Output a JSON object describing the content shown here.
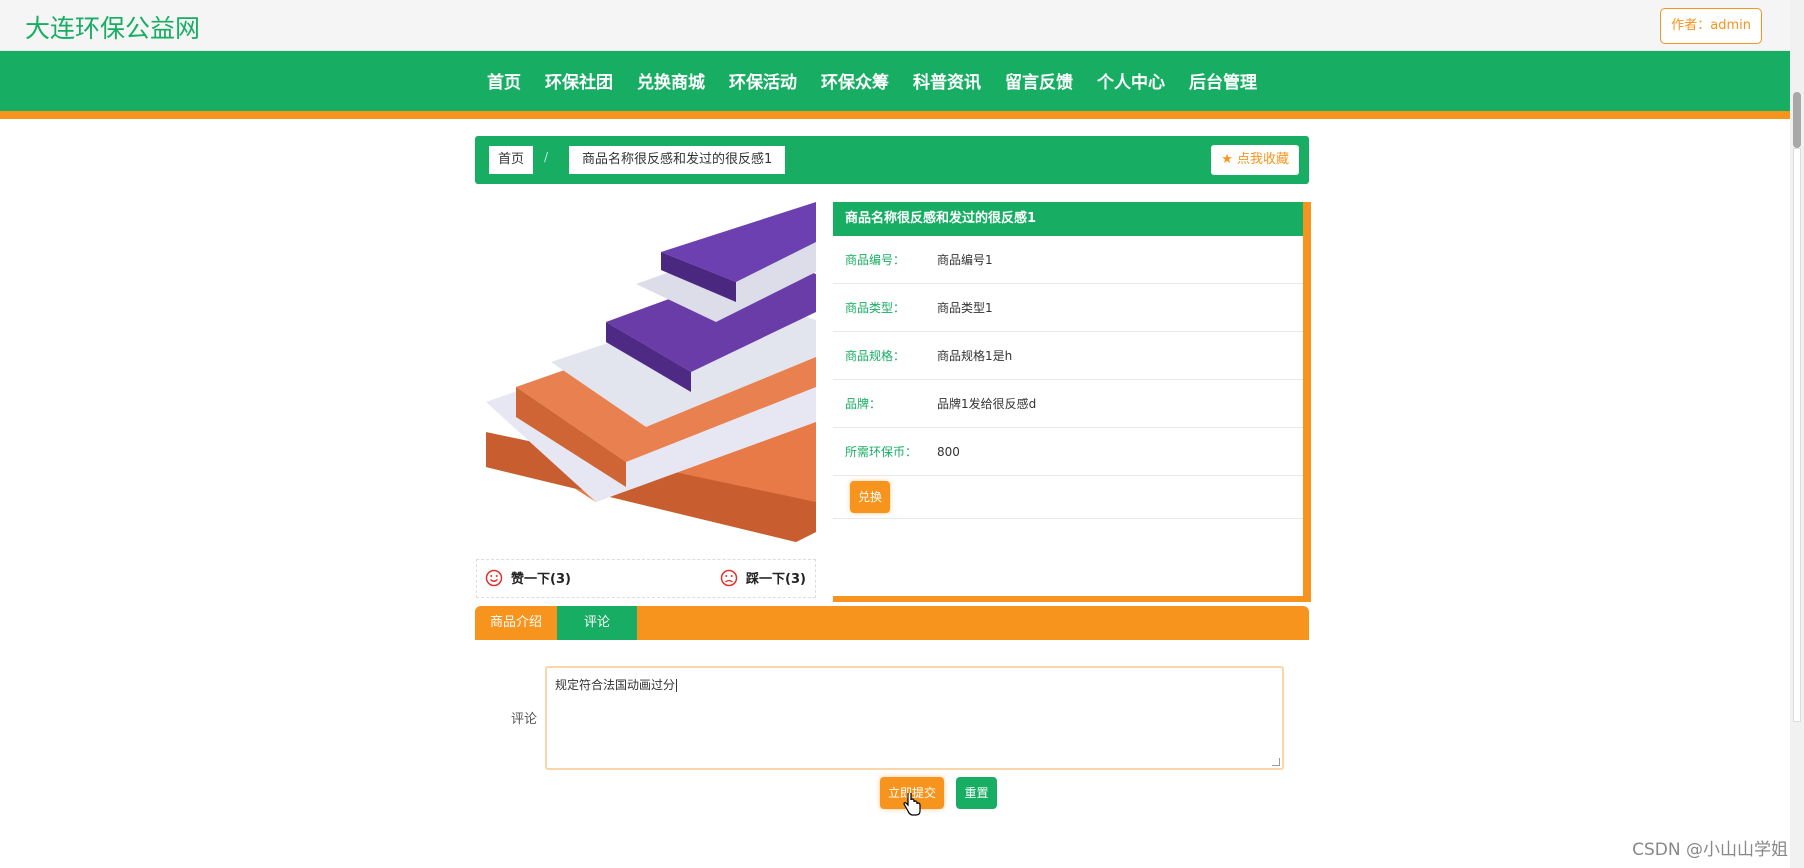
{
  "header": {
    "site_title": "大连环保公益网",
    "author": "作者：admin"
  },
  "nav": {
    "items": [
      "首页",
      "环保社团",
      "兑换商城",
      "环保活动",
      "环保众筹",
      "科普资讯",
      "留言反馈",
      "个人中心",
      "后台管理"
    ]
  },
  "breadcrumb": {
    "home": "首页",
    "separator": "/",
    "current": "商品名称很反感和发过的很反感1",
    "favorite": "点我收藏"
  },
  "product": {
    "title": "商品名称很反感和发过的很反感1",
    "fields": [
      {
        "label": "商品编号：",
        "value": "商品编号1"
      },
      {
        "label": "商品类型：",
        "value": "商品类型1"
      },
      {
        "label": "商品规格：",
        "value": "商品规格1是h"
      },
      {
        "label": "品牌：",
        "value": "品牌1发给很反感d"
      },
      {
        "label": "所需环保币：",
        "value": "800"
      }
    ],
    "exchange_label": "兑换"
  },
  "votes": {
    "like": "赞一下(3)",
    "dislike": "踩一下(3)"
  },
  "tabs": {
    "intro": "商品介绍",
    "comments": "评论"
  },
  "comment_form": {
    "label": "评论",
    "value": "规定符合法国动画过分",
    "submit": "立即提交",
    "reset": "重置"
  },
  "watermark": "CSDN @小山山学姐",
  "colors": {
    "green": "#17ad63",
    "orange": "#f7941d"
  }
}
